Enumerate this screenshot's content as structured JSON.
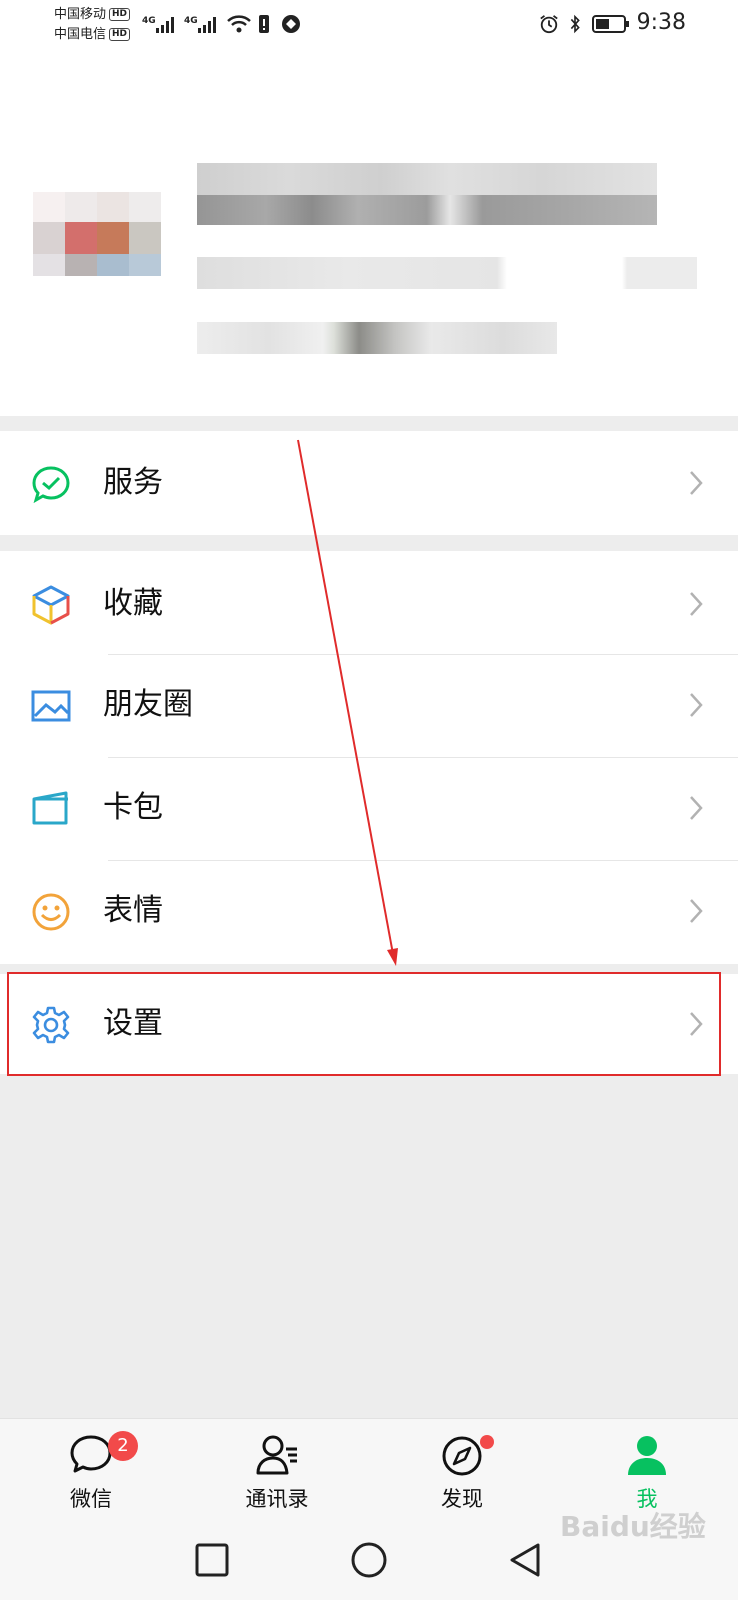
{
  "status_bar": {
    "carrier_1": "中国移动",
    "carrier_2": "中国电信",
    "hd_label": "HD",
    "network_label": "4G",
    "time": "9:38"
  },
  "menu": {
    "services": {
      "label": "服务",
      "icon": "services-icon"
    },
    "favorites": {
      "label": "收藏",
      "icon": "favorites-icon"
    },
    "moments": {
      "label": "朋友圈",
      "icon": "moments-icon"
    },
    "cards": {
      "label": "卡包",
      "icon": "wallet-icon"
    },
    "stickers": {
      "label": "表情",
      "icon": "sticker-icon"
    },
    "settings": {
      "label": "设置",
      "icon": "gear-icon"
    }
  },
  "tabbar": {
    "chats": {
      "label": "微信",
      "badge": "2"
    },
    "contacts": {
      "label": "通讯录"
    },
    "discover": {
      "label": "发现"
    },
    "me": {
      "label": "我"
    }
  },
  "colors": {
    "accent": "#07c160",
    "badge": "#f24a4a",
    "annotation": "#e02b2b"
  },
  "watermark": "Baidu经验"
}
